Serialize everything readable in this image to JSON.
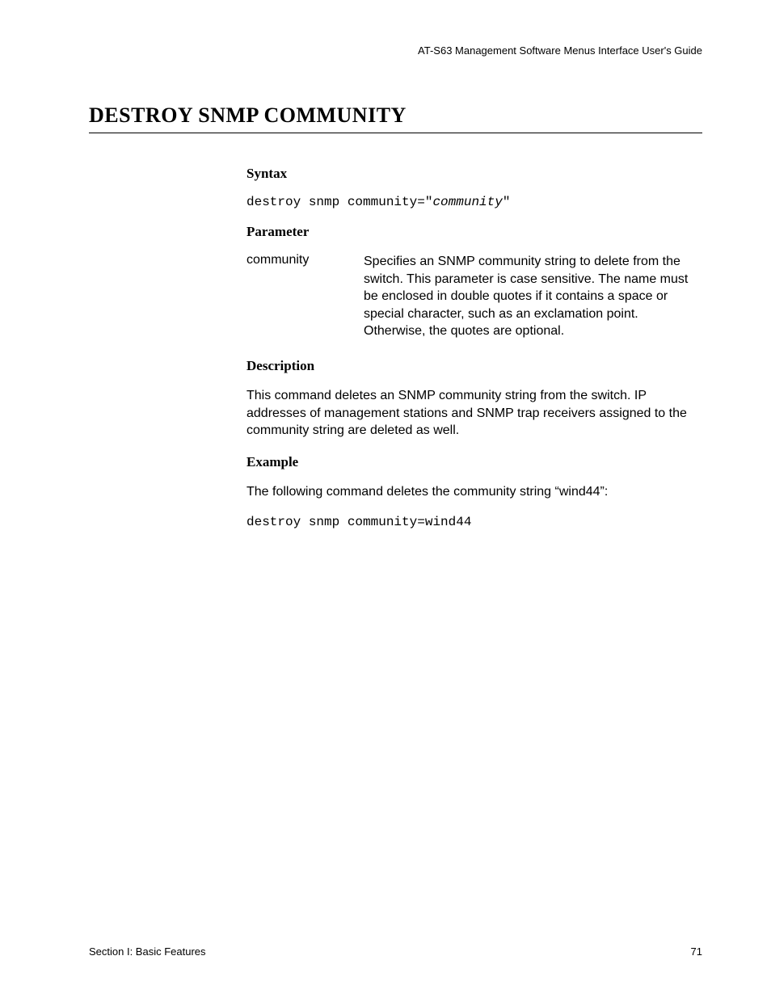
{
  "header": {
    "guide_title": "AT-S63 Management Software Menus Interface User's Guide"
  },
  "title": "DESTROY SNMP COMMUNITY",
  "sections": {
    "syntax": {
      "heading": "Syntax",
      "prefix": "destroy snmp community=\"",
      "variable": "community",
      "suffix": "\""
    },
    "parameter": {
      "heading": "Parameter",
      "name": "community",
      "description": "Specifies an SNMP community string to delete from the switch. This parameter is case sensitive. The name must be enclosed in double quotes if it contains a space or special character, such as an exclamation point. Otherwise, the quotes are optional."
    },
    "description": {
      "heading": "Description",
      "text": "This command deletes an SNMP community string from the switch. IP addresses of management stations and SNMP trap receivers assigned to the community string are deleted as well."
    },
    "example": {
      "heading": "Example",
      "intro": "The following command deletes the community string “wind44”:",
      "code": "destroy snmp community=wind44"
    }
  },
  "footer": {
    "section": "Section I: Basic Features",
    "page": "71"
  }
}
